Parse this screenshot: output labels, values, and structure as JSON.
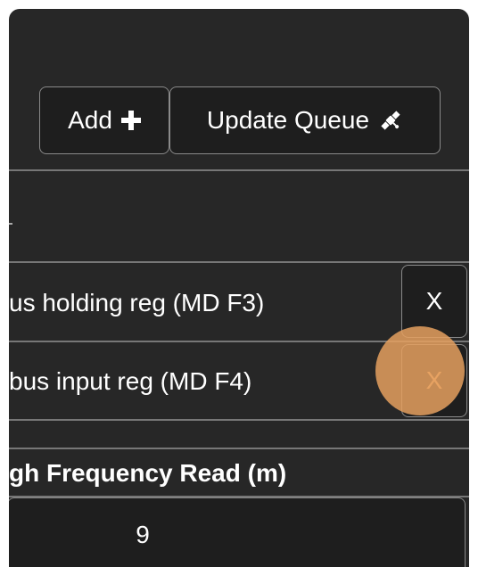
{
  "toolbar": {
    "add_label": "Add",
    "add_icon": "plus-icon",
    "update_label": "Update Queue",
    "update_icon": "satellite-icon"
  },
  "rows": [
    {
      "label": "us holding reg (MD F3)",
      "remove_label": "X"
    },
    {
      "label": "bus input reg (MD F4)",
      "remove_label": "X"
    }
  ],
  "table": {
    "header": "gh Frequency Read (m)",
    "value": "9"
  },
  "colors": {
    "panel_bg": "#272727",
    "button_bg": "#1e1e1e",
    "border": "#8a8a8a",
    "touch_highlight": "#e5a05f"
  }
}
